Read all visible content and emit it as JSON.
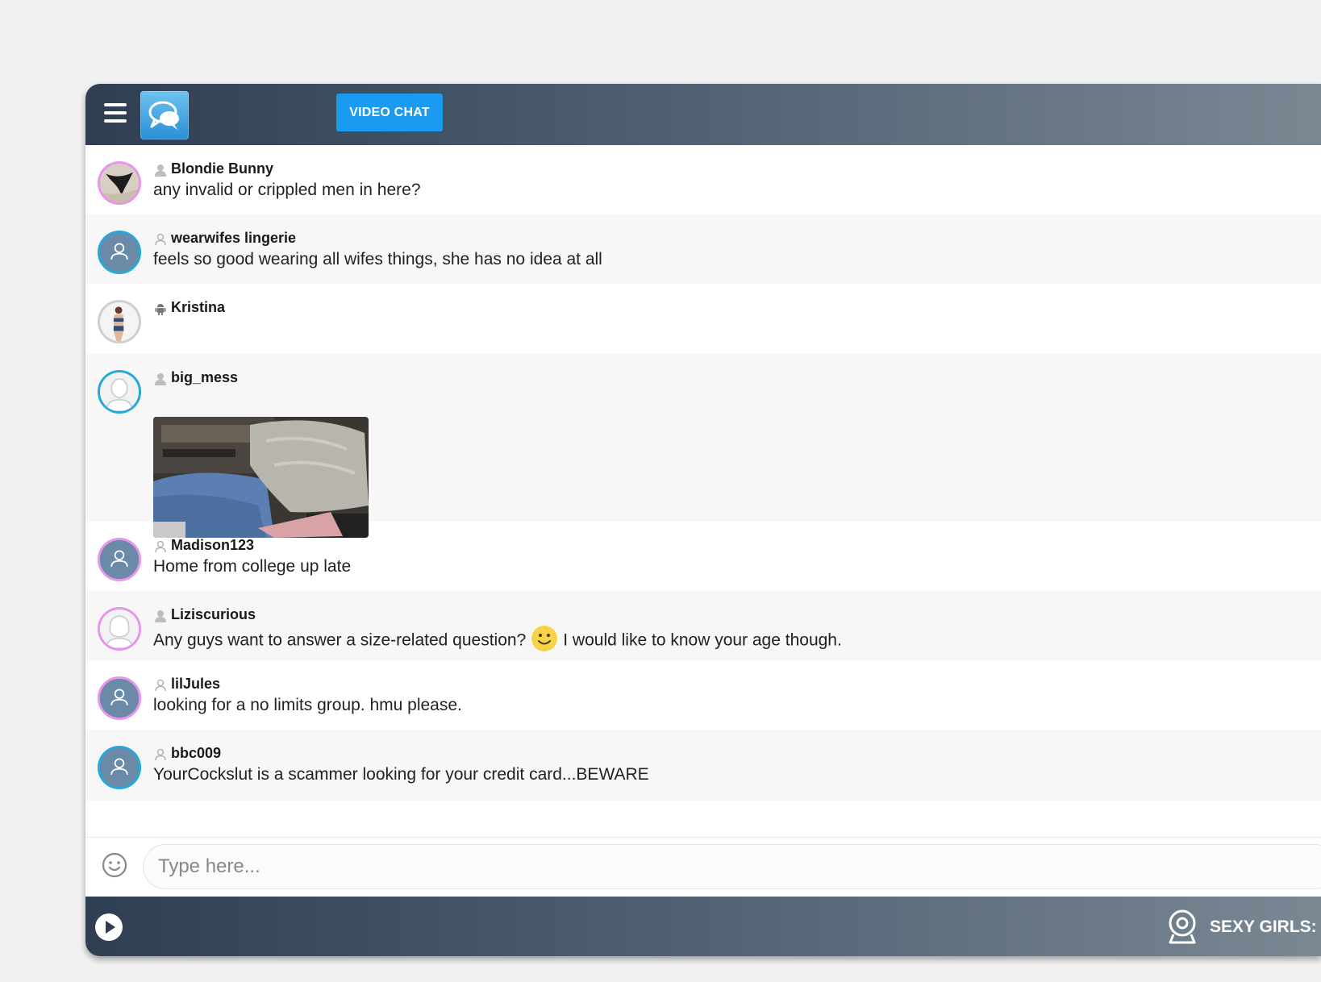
{
  "header": {
    "video_chat_label": "VIDEO CHAT",
    "menu_icon": "hamburger-menu-icon",
    "logo_icon": "chat-bubbles-logo"
  },
  "messages": [
    {
      "name": "Blondie Bunny",
      "text": "any invalid or crippled men in here?",
      "user_icon": "user-filled-icon"
    },
    {
      "name": "wearwifes lingerie",
      "text": "feels so good wearing all wifes things, she has no idea at all",
      "user_icon": "user-outline-icon"
    },
    {
      "name": "Kristina",
      "text": "",
      "user_icon": "android-icon"
    },
    {
      "name": "big_mess",
      "text": "",
      "user_icon": "user-filled-icon",
      "attachment": "photo"
    },
    {
      "name": "Madison123",
      "text": "Home from college up late",
      "user_icon": "user-outline-icon"
    },
    {
      "name": "Liziscurious",
      "text_before": "Any guys want to answer a size-related question?",
      "text_after": "I would like to know your age though.",
      "user_icon": "user-filled-icon"
    },
    {
      "name": "lilJules",
      "text": "looking for a no limits group. hmu please.",
      "user_icon": "user-outline-icon"
    },
    {
      "name": "bbc009",
      "text": "YourCockslut is a scammer looking for your credit card...BEWARE",
      "user_icon": "user-outline-icon"
    }
  ],
  "composer": {
    "placeholder": "Type here..."
  },
  "footer": {
    "sexy_girls_label": "SEXY GIRLS:"
  },
  "colors": {
    "accent_button": "#1b9bf0",
    "bar_gradient_start": "#2f3e52",
    "bar_gradient_end": "#7a8894",
    "avatar_ring_pink": "#e794ea",
    "avatar_ring_blue": "#26a8d9"
  }
}
